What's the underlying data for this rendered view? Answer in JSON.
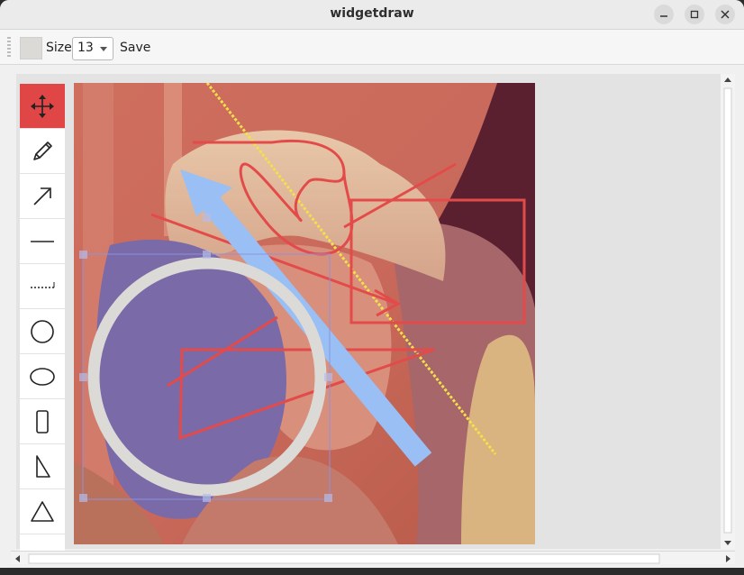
{
  "window": {
    "title": "widgetdraw",
    "controls": [
      "minimize-icon",
      "maximize-icon",
      "close-icon"
    ]
  },
  "toolbar": {
    "color_swatch": "#dcdad6",
    "size_label": "Size",
    "size_value": "13",
    "save_label": "Save"
  },
  "tools": [
    {
      "name": "move-tool",
      "icon": "move-arrows-icon",
      "active": true
    },
    {
      "name": "pen-tool",
      "icon": "pencil-icon",
      "active": false
    },
    {
      "name": "arrow-tool",
      "icon": "arrow-icon",
      "active": false
    },
    {
      "name": "line-tool",
      "icon": "line-icon",
      "active": false
    },
    {
      "name": "dotted-line-tool",
      "icon": "dotted-line-icon",
      "active": false
    },
    {
      "name": "circle-tool",
      "icon": "circle-icon",
      "active": false
    },
    {
      "name": "ellipse-tool",
      "icon": "ellipse-icon",
      "active": false
    },
    {
      "name": "rectangle-tool",
      "icon": "rectangle-icon",
      "active": false
    },
    {
      "name": "right-triangle-tool",
      "icon": "right-triangle-icon",
      "active": false
    },
    {
      "name": "triangle-tool",
      "icon": "triangle-icon",
      "active": false
    }
  ],
  "colors": {
    "accent": "#e04646",
    "stroke_red": "#e34b4b",
    "arrow_blue": "#99bff5",
    "dotted_yellow": "#f4e04a",
    "ring": "#dcdad6",
    "selection": "#8a93e0"
  }
}
